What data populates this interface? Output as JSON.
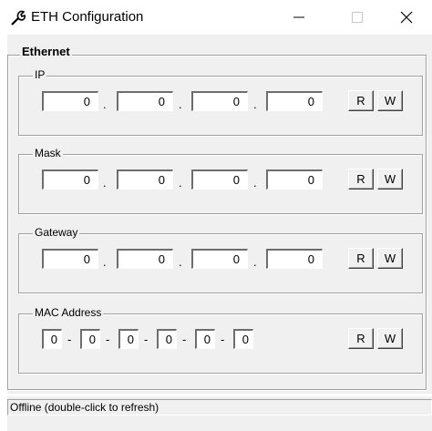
{
  "window": {
    "title": "ETH Configuration",
    "app_icon": "wrench-icon",
    "minimize_icon": "minimize-icon",
    "maximize_icon": "maximize-icon",
    "close_icon": "close-icon"
  },
  "ethernet": {
    "label": "Ethernet",
    "ip": {
      "label": "IP",
      "values": [
        "0",
        "0",
        "0",
        "0"
      ],
      "read_label": "R",
      "write_label": "W"
    },
    "mask": {
      "label": "Mask",
      "values": [
        "0",
        "0",
        "0",
        "0"
      ],
      "read_label": "R",
      "write_label": "W"
    },
    "gateway": {
      "label": "Gateway",
      "values": [
        "0",
        "0",
        "0",
        "0"
      ],
      "read_label": "R",
      "write_label": "W"
    },
    "mac": {
      "label": "MAC Address",
      "values": [
        "0",
        "0",
        "0",
        "0",
        "0",
        "0"
      ],
      "read_label": "R",
      "write_label": "W"
    },
    "dot_sep": ".",
    "dash_sep": "-"
  },
  "status": {
    "text": "Offline (double-click to refresh)"
  }
}
